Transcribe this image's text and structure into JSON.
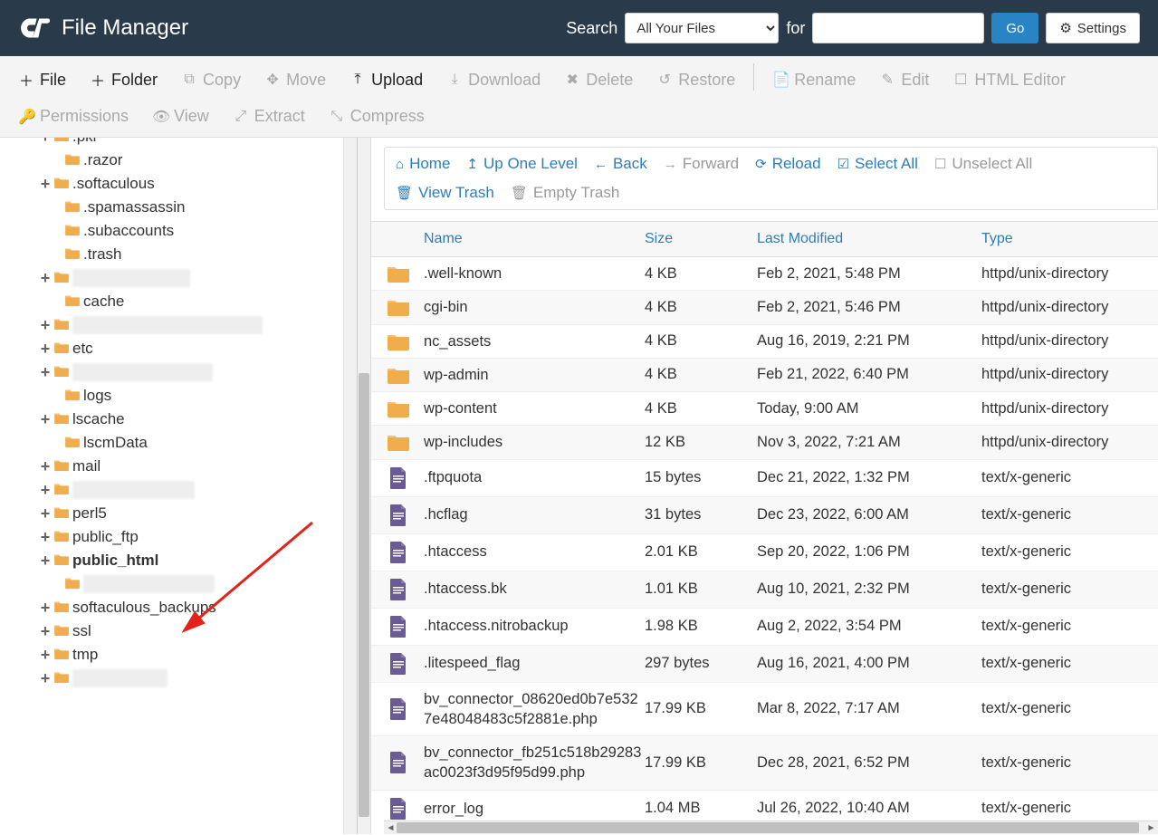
{
  "header": {
    "title": "File Manager",
    "search_label": "Search",
    "for_label": "for",
    "select_value": "All Your Files",
    "go_label": "Go",
    "settings_label": "Settings"
  },
  "toolbar": [
    {
      "icon": "plus",
      "label": "File",
      "state": "darker"
    },
    {
      "icon": "plus",
      "label": "Folder",
      "state": "darker"
    },
    {
      "icon": "copy",
      "label": "Copy",
      "state": "disabled"
    },
    {
      "icon": "move",
      "label": "Move",
      "state": "disabled"
    },
    {
      "icon": "upload",
      "label": "Upload",
      "state": "darker"
    },
    {
      "icon": "download",
      "label": "Download",
      "state": "disabled"
    },
    {
      "icon": "delete",
      "label": "Delete",
      "state": "disabled"
    },
    {
      "icon": "restore",
      "label": "Restore",
      "state": "disabled"
    },
    {
      "sep": true
    },
    {
      "icon": "rename",
      "label": "Rename",
      "state": "disabled"
    },
    {
      "icon": "edit",
      "label": "Edit",
      "state": "disabled"
    },
    {
      "icon": "html",
      "label": "HTML Editor",
      "state": "disabled"
    },
    {
      "icon": "perm",
      "label": "Permissions",
      "state": "disabled"
    },
    {
      "icon": "view",
      "label": "View",
      "state": "disabled"
    },
    {
      "icon": "extract",
      "label": "Extract",
      "state": "disabled"
    },
    {
      "icon": "compress",
      "label": "Compress",
      "state": "disabled"
    }
  ],
  "file_toolbar": [
    {
      "icon": "home",
      "label": "Home",
      "state": ""
    },
    {
      "icon": "up",
      "label": "Up One Level",
      "state": ""
    },
    {
      "icon": "back",
      "label": "Back",
      "state": ""
    },
    {
      "icon": "forward",
      "label": "Forward",
      "state": "disabled"
    },
    {
      "icon": "reload",
      "label": "Reload",
      "state": ""
    },
    {
      "icon": "selectall",
      "label": "Select All",
      "state": ""
    },
    {
      "icon": "unselect",
      "label": "Unselect All",
      "state": "disabled"
    },
    {
      "icon": "trash",
      "label": "View Trash",
      "state": ""
    },
    {
      "icon": "empty",
      "label": "Empty Trash",
      "state": "disabled"
    }
  ],
  "tree": [
    {
      "expand": "+",
      "indent": 0,
      "label": ".pki",
      "partial": true,
      "blur": false
    },
    {
      "expand": "",
      "indent": 1,
      "label": ".razor",
      "blur": false
    },
    {
      "expand": "+",
      "indent": 0,
      "label": ".softaculous",
      "blur": false
    },
    {
      "expand": "",
      "indent": 1,
      "label": ".spamassassin",
      "blur": false
    },
    {
      "expand": "",
      "indent": 1,
      "label": ".subaccounts",
      "blur": false
    },
    {
      "expand": "",
      "indent": 1,
      "label": ".trash",
      "blur": false
    },
    {
      "expand": "+",
      "indent": 0,
      "label": "hidden-one",
      "blur": true,
      "blurW": 130
    },
    {
      "expand": "",
      "indent": 1,
      "label": "cache",
      "blur": false
    },
    {
      "expand": "+",
      "indent": 0,
      "label": "hidden-long-folder-name",
      "blur": true,
      "blurW": 210
    },
    {
      "expand": "+",
      "indent": 0,
      "label": "etc",
      "blur": false
    },
    {
      "expand": "+",
      "indent": 0,
      "label": "hidden-med-folder",
      "blur": true,
      "blurW": 155
    },
    {
      "expand": "",
      "indent": 1,
      "label": "logs",
      "blur": false
    },
    {
      "expand": "+",
      "indent": 0,
      "label": "lscache",
      "blur": false
    },
    {
      "expand": "",
      "indent": 1,
      "label": "lscmData",
      "blur": false
    },
    {
      "expand": "+",
      "indent": 0,
      "label": "mail",
      "blur": false
    },
    {
      "expand": "+",
      "indent": 0,
      "label": "hidden-one-2",
      "blur": true,
      "blurW": 135
    },
    {
      "expand": "+",
      "indent": 0,
      "label": "perl5",
      "blur": false
    },
    {
      "expand": "+",
      "indent": 0,
      "label": "public_ftp",
      "blur": false
    },
    {
      "expand": "+",
      "indent": 0,
      "label": "public_html",
      "blur": false,
      "selected": true
    },
    {
      "expand": "",
      "indent": 1,
      "label": "hidden-sub",
      "blur": true,
      "blurW": 145
    },
    {
      "expand": "+",
      "indent": 0,
      "label": "softaculous_backups",
      "blur": false
    },
    {
      "expand": "+",
      "indent": 0,
      "label": "ssl",
      "blur": false
    },
    {
      "expand": "+",
      "indent": 0,
      "label": "tmp",
      "blur": false
    },
    {
      "expand": "+",
      "indent": 0,
      "label": "hidden-last",
      "blur": true,
      "blurW": 105
    }
  ],
  "columns": {
    "name": "Name",
    "size": "Size",
    "modified": "Last Modified",
    "type": "Type"
  },
  "files": [
    {
      "t": "folder",
      "name": ".well-known",
      "size": "4 KB",
      "date": "Feb 2, 2021, 5:48 PM",
      "type": "httpd/unix-directory"
    },
    {
      "t": "folder",
      "name": "cgi-bin",
      "size": "4 KB",
      "date": "Feb 2, 2021, 5:46 PM",
      "type": "httpd/unix-directory"
    },
    {
      "t": "folder",
      "name": "nc_assets",
      "size": "4 KB",
      "date": "Aug 16, 2019, 2:21 PM",
      "type": "httpd/unix-directory"
    },
    {
      "t": "folder",
      "name": "wp-admin",
      "size": "4 KB",
      "date": "Feb 21, 2022, 6:40 PM",
      "type": "httpd/unix-directory"
    },
    {
      "t": "folder",
      "name": "wp-content",
      "size": "4 KB",
      "date": "Today, 9:00 AM",
      "type": "httpd/unix-directory"
    },
    {
      "t": "folder",
      "name": "wp-includes",
      "size": "12 KB",
      "date": "Nov 3, 2022, 7:21 AM",
      "type": "httpd/unix-directory"
    },
    {
      "t": "file",
      "name": ".ftpquota",
      "size": "15 bytes",
      "date": "Dec 21, 2022, 1:32 PM",
      "type": "text/x-generic"
    },
    {
      "t": "file",
      "name": ".hcflag",
      "size": "31 bytes",
      "date": "Dec 23, 2022, 6:00 AM",
      "type": "text/x-generic"
    },
    {
      "t": "file",
      "name": ".htaccess",
      "size": "2.01 KB",
      "date": "Sep 20, 2022, 1:06 PM",
      "type": "text/x-generic"
    },
    {
      "t": "file",
      "name": ".htaccess.bk",
      "size": "1.01 KB",
      "date": "Aug 10, 2021, 2:32 PM",
      "type": "text/x-generic"
    },
    {
      "t": "file",
      "name": ".htaccess.nitrobackup",
      "size": "1.98 KB",
      "date": "Aug 2, 2022, 3:54 PM",
      "type": "text/x-generic"
    },
    {
      "t": "file",
      "name": ".litespeed_flag",
      "size": "297 bytes",
      "date": "Aug 16, 2021, 4:00 PM",
      "type": "text/x-generic"
    },
    {
      "t": "file",
      "name": "bv_connector_08620ed0b7e5327e48048483c5f2881e.php",
      "size": "17.99 KB",
      "date": "Mar 8, 2022, 7:17 AM",
      "type": "text/x-generic"
    },
    {
      "t": "file",
      "name": "bv_connector_fb251c518b29283ac0023f3d95f95d99.php",
      "size": "17.99 KB",
      "date": "Dec 28, 2021, 6:52 PM",
      "type": "text/x-generic"
    },
    {
      "t": "file",
      "name": "error_log",
      "size": "1.04 MB",
      "date": "Jul 26, 2022, 10:40 AM",
      "type": "text/x-generic"
    }
  ]
}
